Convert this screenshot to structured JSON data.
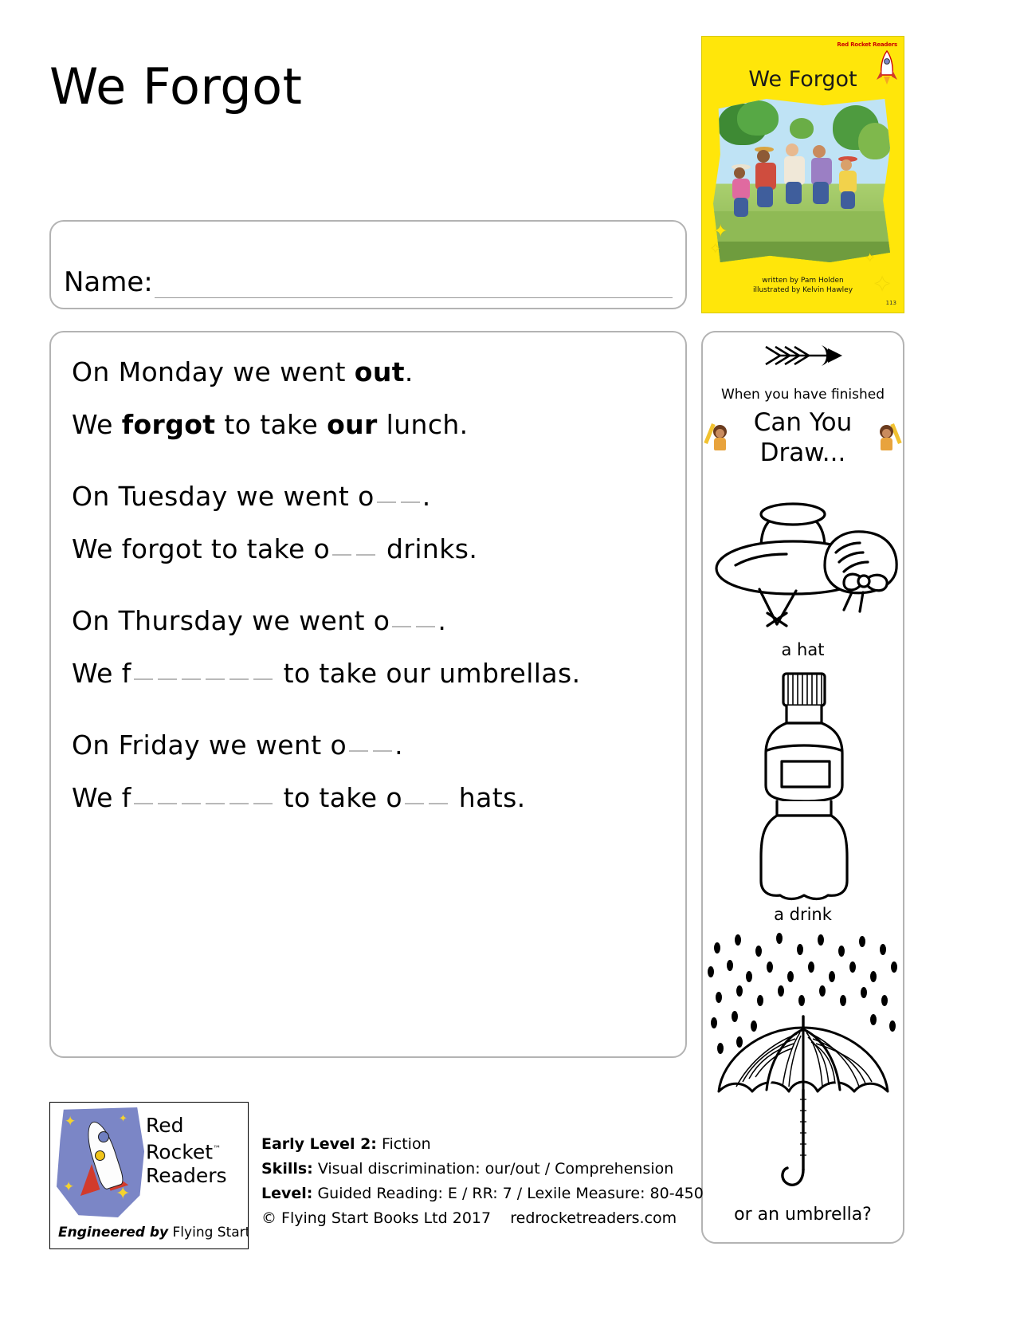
{
  "page": {
    "title": "We Forgot"
  },
  "book_cover": {
    "brand": "Red Rocket Readers",
    "title": "We Forgot",
    "written_by": "written by Pam Holden",
    "illustrated_by": "illustrated by Kelvin Hawley",
    "number": "113",
    "background_color": "#ffe60a"
  },
  "name_field": {
    "label": "Name:",
    "value": "",
    "placeholder": ""
  },
  "exercise": {
    "lines": [
      {
        "id": "monday-sentence",
        "parts": [
          {
            "t": "text",
            "v": "On Monday we went "
          },
          {
            "t": "bold",
            "v": "out"
          },
          {
            "t": "text",
            "v": "."
          }
        ]
      },
      {
        "id": "monday-answer",
        "parts": [
          {
            "t": "text",
            "v": "We "
          },
          {
            "t": "bold",
            "v": "forgot"
          },
          {
            "t": "text",
            "v": " to take "
          },
          {
            "t": "bold",
            "v": "our"
          },
          {
            "t": "text",
            "v": " lunch."
          }
        ]
      },
      {
        "id": "tuesday-sentence",
        "parts": [
          {
            "t": "text",
            "v": "On Tuesday we went o"
          },
          {
            "t": "blank",
            "v": "short"
          },
          {
            "t": "blank",
            "v": "short"
          },
          {
            "t": "text",
            "v": "."
          }
        ]
      },
      {
        "id": "tuesday-answer",
        "parts": [
          {
            "t": "text",
            "v": "We forgot to take o"
          },
          {
            "t": "blank",
            "v": "short"
          },
          {
            "t": "blank",
            "v": "short"
          },
          {
            "t": "text",
            "v": " drinks."
          }
        ]
      },
      {
        "id": "thursday-sentence",
        "parts": [
          {
            "t": "text",
            "v": "On Thursday we went o"
          },
          {
            "t": "blank",
            "v": "short"
          },
          {
            "t": "blank",
            "v": "short"
          },
          {
            "t": "text",
            "v": "."
          }
        ]
      },
      {
        "id": "thursday-answer",
        "parts": [
          {
            "t": "text",
            "v": "We f"
          },
          {
            "t": "blank",
            "v": "short"
          },
          {
            "t": "blank",
            "v": "short"
          },
          {
            "t": "blank",
            "v": "short"
          },
          {
            "t": "blank",
            "v": "short"
          },
          {
            "t": "blank",
            "v": "short"
          },
          {
            "t": "blank",
            "v": "short"
          },
          {
            "t": "text",
            "v": " to take our umbrellas."
          }
        ]
      },
      {
        "id": "friday-sentence",
        "parts": [
          {
            "t": "text",
            "v": "On Friday we went o"
          },
          {
            "t": "blank",
            "v": "short"
          },
          {
            "t": "blank",
            "v": "short"
          },
          {
            "t": "text",
            "v": "."
          }
        ]
      },
      {
        "id": "friday-answer",
        "parts": [
          {
            "t": "text",
            "v": "We f"
          },
          {
            "t": "blank",
            "v": "short"
          },
          {
            "t": "blank",
            "v": "short"
          },
          {
            "t": "blank",
            "v": "short"
          },
          {
            "t": "blank",
            "v": "short"
          },
          {
            "t": "blank",
            "v": "short"
          },
          {
            "t": "blank",
            "v": "short"
          },
          {
            "t": "text",
            "v": " to take o"
          },
          {
            "t": "blank",
            "v": "short"
          },
          {
            "t": "blank",
            "v": "short"
          },
          {
            "t": "text",
            "v": " hats."
          }
        ]
      }
    ]
  },
  "activity": {
    "arrow_icon": "feathered-arrow-icon",
    "finished_text": "When you have finished",
    "heading_line1": "Can You",
    "heading_line2": "Draw...",
    "items": [
      {
        "icon": "hat-icon",
        "caption": "a hat"
      },
      {
        "icon": "drink-bottle-icon",
        "caption": "a drink"
      },
      {
        "icon": "umbrella-icon",
        "caption": "or an umbrella?"
      }
    ]
  },
  "logo": {
    "line1": "Red",
    "line2": "Rocket",
    "line3": "Readers",
    "tm": "™",
    "engineered_prefix": "Engineered by",
    "engineered_suffix": "Flying Start Books"
  },
  "metadata": {
    "level_label": "Early Level 2:",
    "level_value": "Fiction",
    "skills_label": "Skills:",
    "skills_value": "Visual discrimination: our/out / Comprehension",
    "reading_label": "Level:",
    "reading_value": "Guided Reading: E / RR: 7 / Lexile Measure: 80-450",
    "copyright": "© Flying Start Books Ltd 2017",
    "website": "redrocketreaders.com"
  }
}
